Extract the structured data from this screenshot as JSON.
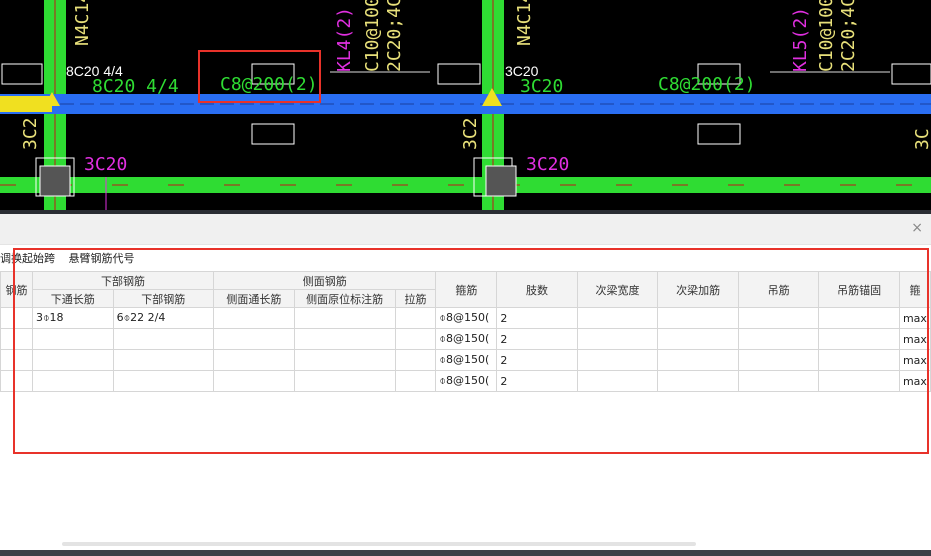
{
  "cad": {
    "labels": {
      "n4c14_left": "N4C14",
      "n4c14_right": "N4C14",
      "kl4": "KL4(2)",
      "kl5": "KL5(2)",
      "c10_left": "C10@100(2",
      "c10_right": "C10@100(2",
      "c2c20_left": "2C20;4C2",
      "c2c20_right": "2C20;4C2",
      "top_8c20": "8C20 4/4",
      "top_8c20_green": "8C20 4/4",
      "c8_left": "C8@200(2)",
      "c8_right": "C8@200(2)",
      "c3c20_top": "3C20",
      "c3c20_right_top": "3C20",
      "c3c20_mag_left": "3C20",
      "c3c20_mag_right": "3C20",
      "c3c2_left": "3C2",
      "c3c2_mid": "3C2",
      "c3c2_right": "3C"
    },
    "colors": {
      "background": "#000000",
      "beam_blue": "#2a6ef2",
      "beam_green": "#2fdc33",
      "yellow_text": "#e8e07a",
      "magenta": "#e02fe0",
      "green_text": "#2fdc33",
      "highlight": "#e8322a"
    }
  },
  "panel": {
    "close_icon": "×",
    "toolbar": [
      "调换起始跨",
      "悬臂钢筋代号"
    ],
    "header_groups": {
      "col0": "钢筋",
      "bottom": "下部钢筋",
      "side": "侧面钢筋"
    },
    "headers": {
      "col0": "钢筋",
      "bottom_through": "下通长筋",
      "bottom_bar": "下部钢筋",
      "side_through": "侧面通长筋",
      "side_orig": "侧面原位标注筋",
      "tie": "拉筋",
      "stirrup": "箍筋",
      "legs": "肢数",
      "sec_width": "次梁宽度",
      "sec_add": "次梁加筋",
      "hanger": "吊筋",
      "hanger_anchor": "吊筋锚固",
      "last": "箍"
    },
    "rows": [
      {
        "col0": "",
        "bottom_through": "3⌽18",
        "bottom_bar": "6⌽22 2/4",
        "side_through": "",
        "side_orig": "",
        "tie": "",
        "stirrup": "⌽8@150(",
        "legs": "2",
        "sec_width": "",
        "sec_add": "",
        "hanger": "",
        "hanger_anchor": "",
        "last": "max"
      },
      {
        "col0": "",
        "bottom_through": "",
        "bottom_bar": "",
        "side_through": "",
        "side_orig": "",
        "tie": "",
        "stirrup": "⌽8@150(",
        "legs": "2",
        "sec_width": "",
        "sec_add": "",
        "hanger": "",
        "hanger_anchor": "",
        "last": "max"
      },
      {
        "col0": "",
        "bottom_through": "",
        "bottom_bar": "",
        "side_through": "",
        "side_orig": "",
        "tie": "",
        "stirrup": "⌽8@150(",
        "legs": "2",
        "sec_width": "",
        "sec_add": "",
        "hanger": "",
        "hanger_anchor": "",
        "last": "max"
      },
      {
        "col0": "",
        "bottom_through": "",
        "bottom_bar": "",
        "side_through": "",
        "side_orig": "",
        "tie": "",
        "stirrup": "⌽8@150(",
        "legs": "2",
        "sec_width": "",
        "sec_add": "",
        "hanger": "",
        "hanger_anchor": "",
        "last": "max"
      }
    ]
  }
}
